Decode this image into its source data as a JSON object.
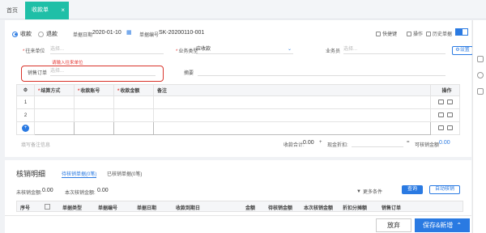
{
  "tabs": {
    "home": "首页",
    "active": "收款单",
    "close": "×"
  },
  "header": {
    "receive": "收款",
    "refund": "退款",
    "date_label": "单据日期",
    "date_value": "2020-01-10",
    "no_label": "单据编号",
    "no_value": "SK-20200110-001",
    "shortcut": "快捷键",
    "operate": "操作",
    "history": "历史单据"
  },
  "form": {
    "unit_label": "往来单位",
    "unit_placeholder": "选择...",
    "unit_error": "请输入往来单位",
    "type_label": "业务类型",
    "type_value": "应收款",
    "staff_label": "业务员",
    "staff_placeholder": "选择...",
    "settings": "设置",
    "order_label": "销售订单",
    "order_placeholder": "选择...",
    "summary_label": "摘要"
  },
  "grid": {
    "headers": [
      "结算方式",
      "收款账号",
      "收款金额",
      "备注",
      "操作"
    ],
    "rows": [
      "1",
      "2"
    ]
  },
  "summary": {
    "note_placeholder": "填写备注信息",
    "total_label": "收款合计:",
    "total_value": "0.00",
    "discount_label": "现金折扣:",
    "discount_value": "",
    "writeoff_label": "可核销金额",
    "writeoff_value": "0.00"
  },
  "detail": {
    "title": "核销明细",
    "tab_pending": "待核销单据(0笔)",
    "tab_done": "已核销单据(0笔)",
    "unwritten_label": "未核销金额:",
    "unwritten_value": "0.00",
    "this_label": "本次核销金额:",
    "this_value": "0.00",
    "more": "更多条件",
    "query": "查询",
    "auto": "自动核销",
    "columns": [
      "序号",
      "单据类型",
      "单据编号",
      "单据日期",
      "收款到期日",
      "金额",
      "待核销金额",
      "本次核销金额",
      "折扣分摊额",
      "销售订单"
    ]
  },
  "footer": {
    "cancel": "放弃",
    "save_new": "保存&新增"
  }
}
